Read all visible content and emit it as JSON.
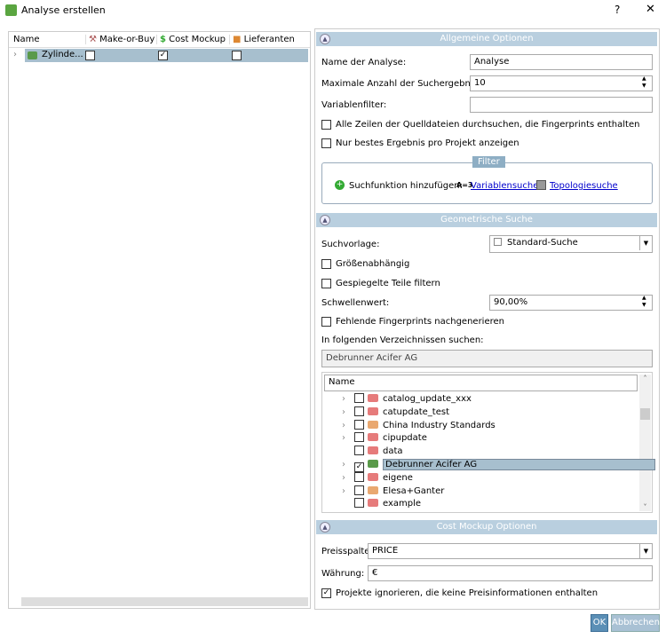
{
  "window": {
    "title": "Analyse erstellen",
    "help": "?",
    "close": "✕"
  },
  "left": {
    "columns": [
      "Name",
      "Make-or-Buy",
      "Cost Mockup",
      "Lieferanten"
    ],
    "row": {
      "name": "Zylinde...",
      "make_or_buy": false,
      "cost_mockup": true,
      "lieferanten": false
    }
  },
  "general": {
    "title": "Allgemeine Optionen",
    "name_label": "Name der Analyse:",
    "name_value": "Analyse",
    "max_label": "Maximale Anzahl der Suchergebnisse:",
    "max_value": "10",
    "var_label": "Variablenfilter:",
    "var_value": "",
    "all_rows_label": "Alle Zeilen der Quelldateien durchsuchen, die Fingerprints enthalten",
    "best_label": "Nur bestes Ergebnis pro Projekt anzeigen",
    "filter_title": "Filter",
    "add_label": "Suchfunktion hinzufügen:",
    "var_icon": "A=3",
    "var_link": "Variablensuche",
    "topo_link": "Topologiesuche"
  },
  "geo": {
    "title": "Geometrische Suche",
    "template_label": "Suchvorlage:",
    "template_value": "Standard-Suche",
    "size_label": "Größenabhängig",
    "mirror_label": "Gespiegelte Teile filtern",
    "threshold_label": "Schwellenwert:",
    "threshold_value": "90,00%",
    "missing_label": "Fehlende Fingerprints nachgenerieren",
    "dirs_label": "In folgenden Verzeichnissen suchen:",
    "dirs_value": "Debrunner Acifer AG",
    "tree_header": "Name",
    "tree": [
      {
        "name": "catalog_update_xxx",
        "expand": true,
        "checked": false,
        "color": "#e67b7b"
      },
      {
        "name": "catupdate_test",
        "expand": true,
        "checked": false,
        "color": "#e67b7b"
      },
      {
        "name": "China Industry Standards",
        "expand": true,
        "checked": false,
        "color": "#e9a870"
      },
      {
        "name": "cipupdate",
        "expand": true,
        "checked": false,
        "color": "#e67b7b"
      },
      {
        "name": "data",
        "expand": false,
        "checked": false,
        "color": "#e67b7b"
      },
      {
        "name": "Debrunner Acifer AG",
        "expand": true,
        "checked": true,
        "color": "#5a9a4a",
        "selected": true
      },
      {
        "name": "eigene",
        "expand": true,
        "checked": false,
        "color": "#e67b7b"
      },
      {
        "name": "Elesa+Ganter",
        "expand": true,
        "checked": false,
        "color": "#e9a870"
      },
      {
        "name": "example",
        "expand": false,
        "checked": false,
        "color": "#e67b7b"
      }
    ]
  },
  "cost": {
    "title": "Cost Mockup Optionen",
    "price_label": "Preisspalte:",
    "price_value": "PRICE",
    "currency_label": "Währung:",
    "currency_value": "€",
    "ignore_label": "Projekte ignorieren, die keine Preisinformationen enthalten"
  },
  "buttons": {
    "ok": "OK",
    "cancel": "Abbrechen"
  }
}
